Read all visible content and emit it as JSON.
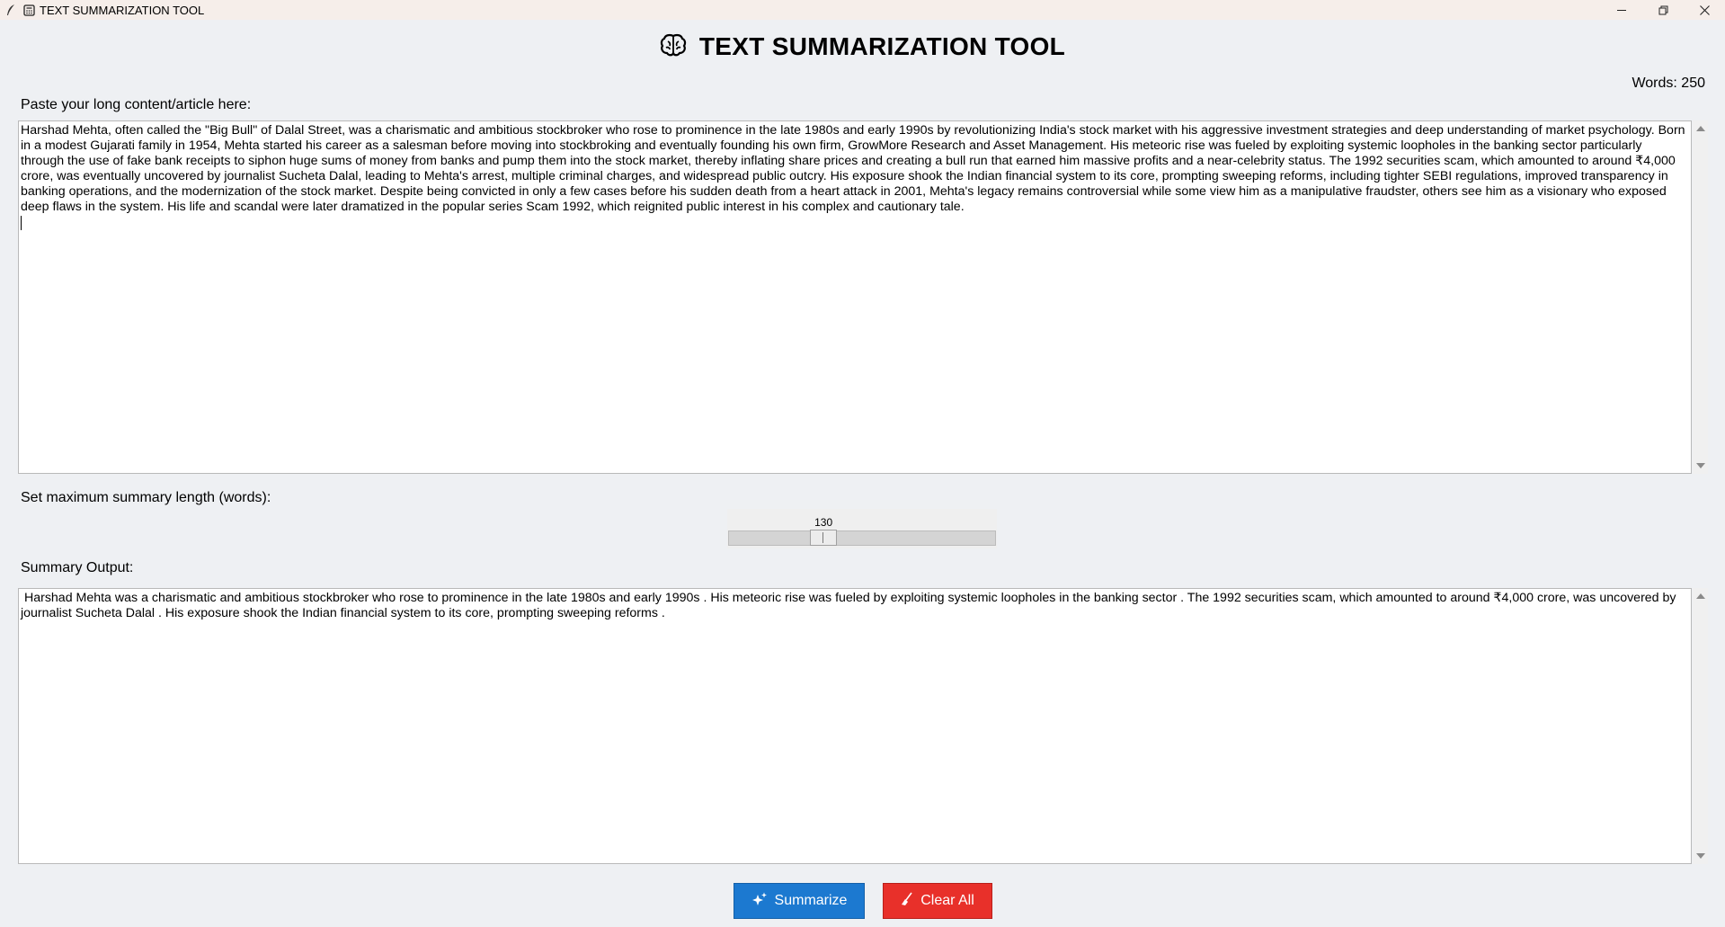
{
  "window": {
    "title": "TEXT SUMMARIZATION TOOL",
    "app_icon": "feather-icon",
    "title_icon": "calculator-icon"
  },
  "header": {
    "title": "TEXT SUMMARIZATION TOOL",
    "icon": "brain-icon"
  },
  "word_count": "Words: 250",
  "input": {
    "label": "Paste your long content/article here:",
    "text": "Harshad Mehta, often called the \"Big Bull\" of Dalal Street, was a charismatic and ambitious stockbroker who rose to prominence in the late 1980s and early 1990s by revolutionizing India's stock market with his aggressive investment strategies and deep understanding of market psychology. Born in a modest Gujarati family in 1954, Mehta started his career as a salesman before moving into stockbroking and eventually founding his own firm, GrowMore Research and Asset Management. His meteoric rise was fueled by exploiting systemic loopholes in the banking sector particularly through the use of fake bank receipts to siphon huge sums of money from banks and pump them into the stock market, thereby inflating share prices and creating a bull run that earned him massive profits and a near-celebrity status. The 1992 securities scam, which amounted to around ₹4,000 crore, was eventually uncovered by journalist Sucheta Dalal, leading to Mehta's arrest, multiple criminal charges, and widespread public outcry. His exposure shook the Indian financial system to its core, prompting sweeping reforms, including tighter SEBI regulations, improved transparency in banking operations, and the modernization of the stock market. Despite being convicted in only a few cases before his sudden death from a heart attack in 2001, Mehta's legacy remains controversial while some view him as a manipulative fraudster, others see him as a visionary who exposed deep flaws in the system. His life and scandal were later dramatized in the popular series Scam 1992, which reignited public interest in his complex and cautionary tale."
  },
  "slider": {
    "label": "Set maximum summary length (words):",
    "value": "130",
    "fraction": 0.34
  },
  "output": {
    "label": "Summary Output:",
    "text": " Harshad Mehta was a charismatic and ambitious stockbroker who rose to prominence in the late 1980s and early 1990s . His meteoric rise was fueled by exploiting systemic loopholes in the banking sector . The 1992 securities scam, which amounted to around ₹4,000 crore, was uncovered by journalist Sucheta Dalal . His exposure shook the Indian financial system to its core, prompting sweeping reforms ."
  },
  "buttons": {
    "summarize_label": "Summarize",
    "summarize_icon": "sparkles-icon",
    "summarize_color": "#1c79d0",
    "clear_label": "Clear All",
    "clear_icon": "broom-icon",
    "clear_color": "#e8302a"
  }
}
